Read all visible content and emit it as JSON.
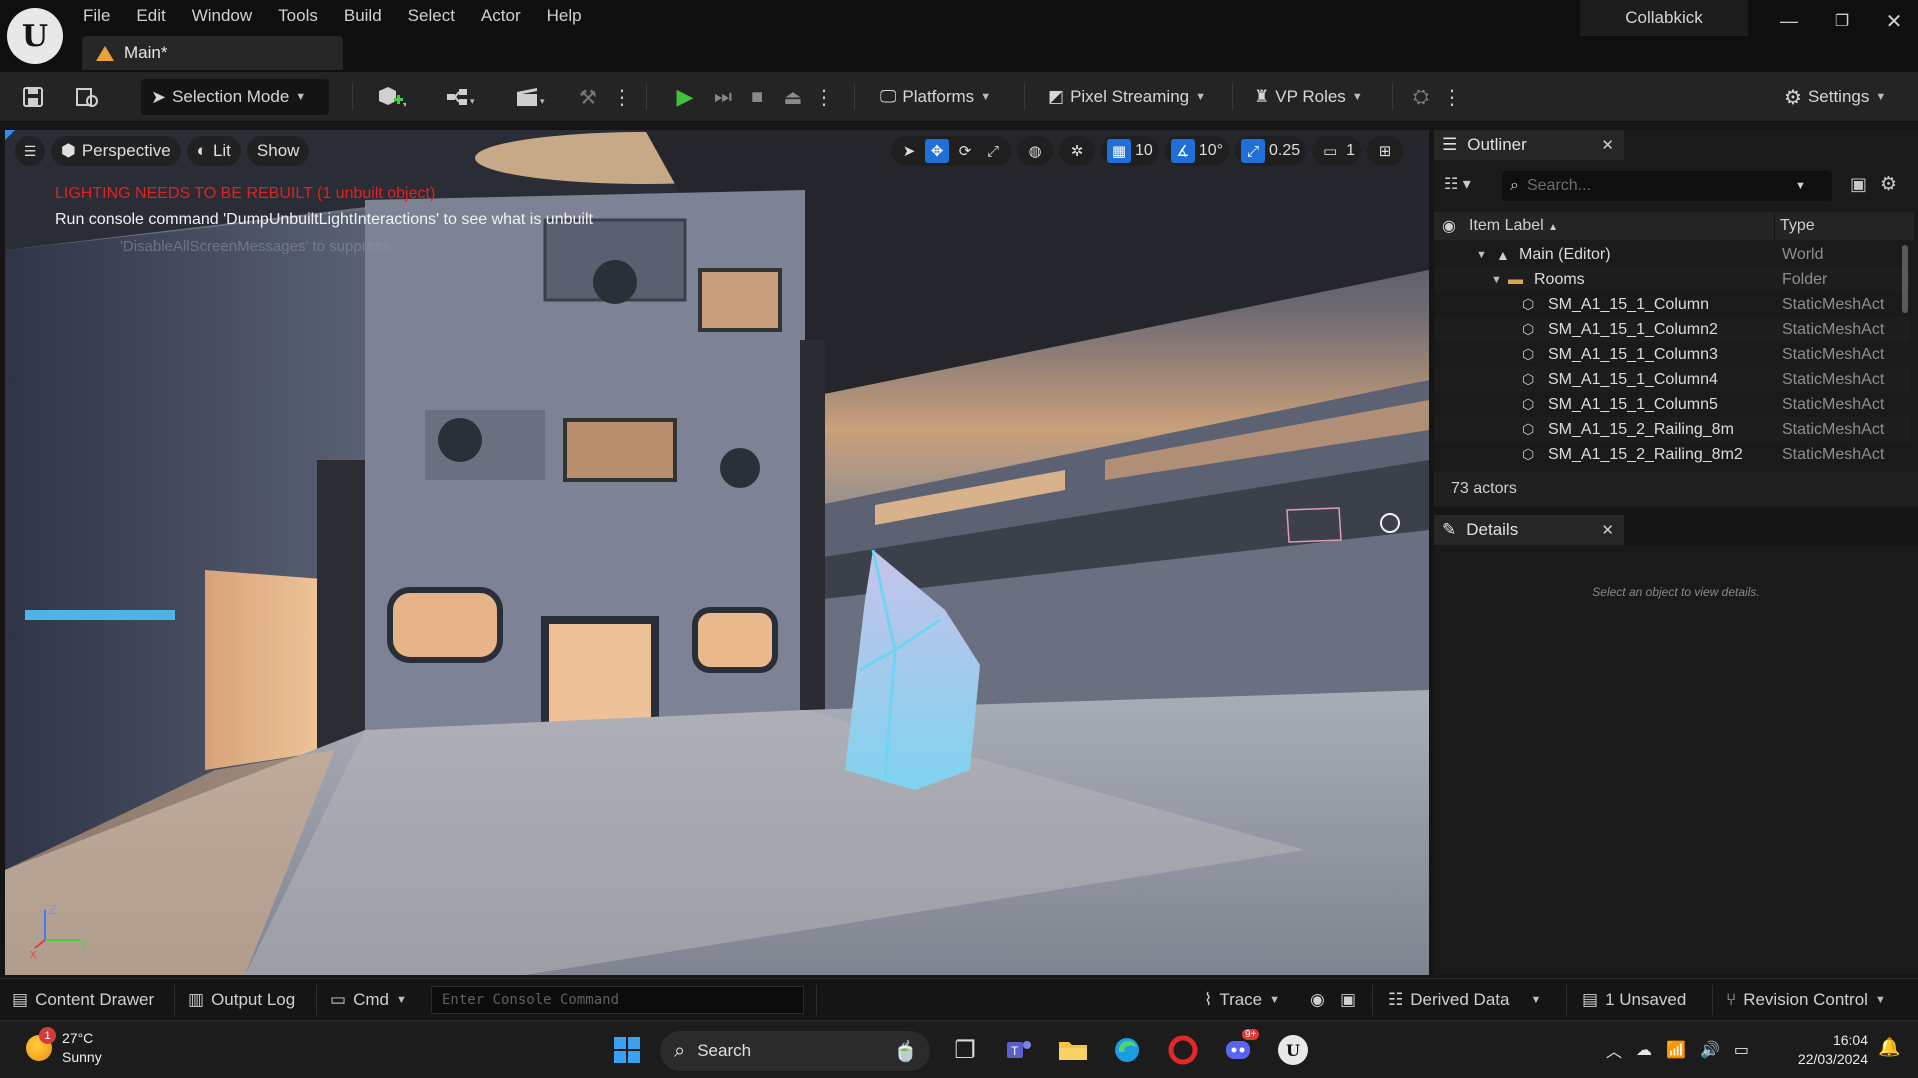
{
  "app": {
    "menu": [
      "File",
      "Edit",
      "Window",
      "Tools",
      "Build",
      "Select",
      "Actor",
      "Help"
    ],
    "document_tab": "Main*",
    "project_name": "Collabkick"
  },
  "toolbar": {
    "mode_label": "Selection Mode",
    "platforms_label": "Platforms",
    "pixel_streaming_label": "Pixel Streaming",
    "vp_roles_label": "VP Roles",
    "settings_label": "Settings"
  },
  "viewport": {
    "perspective_label": "Perspective",
    "lit_label": "Lit",
    "show_label": "Show",
    "grid_snap": "10",
    "rotation_snap": "10°",
    "scale_snap": "0.25",
    "camera_speed": "1",
    "warning_message": "LIGHTING NEEDS TO BE REBUILT (1 unbuilt object)",
    "info_message": "Run console command 'DumpUnbuiltLightInteractions' to see what is unbuilt",
    "faint_message": "'DisableAllScreenMessages' to suppress",
    "axis": {
      "x": "x",
      "y": "y",
      "z": "Z"
    }
  },
  "outliner": {
    "title": "Outliner",
    "search_placeholder": "Search...",
    "col_label": "Item Label",
    "col_type": "Type",
    "rows": [
      {
        "label": "Main (Editor)",
        "type": "World"
      },
      {
        "label": "Rooms",
        "type": "Folder"
      },
      {
        "label": "SM_A1_15_1_Column",
        "type": "StaticMeshAct"
      },
      {
        "label": "SM_A1_15_1_Column2",
        "type": "StaticMeshAct"
      },
      {
        "label": "SM_A1_15_1_Column3",
        "type": "StaticMeshAct"
      },
      {
        "label": "SM_A1_15_1_Column4",
        "type": "StaticMeshAct"
      },
      {
        "label": "SM_A1_15_1_Column5",
        "type": "StaticMeshAct"
      },
      {
        "label": "SM_A1_15_2_Railing_8m",
        "type": "StaticMeshAct"
      },
      {
        "label": "SM_A1_15_2_Railing_8m2",
        "type": "StaticMeshAct"
      }
    ],
    "footer": "73 actors"
  },
  "details": {
    "title": "Details",
    "empty_message": "Select an object to view details."
  },
  "statusbar": {
    "content_drawer": "Content Drawer",
    "output_log": "Output Log",
    "cmd": "Cmd",
    "console_placeholder": "Enter Console Command",
    "trace": "Trace",
    "derived_data": "Derived Data",
    "unsaved": "1 Unsaved",
    "revision_control": "Revision Control"
  },
  "taskbar": {
    "temperature": "27°C",
    "condition": "Sunny",
    "weather_badge": "1",
    "search_label": "Search",
    "discord_badge": "9+",
    "time": "16:04",
    "date": "22/03/2024"
  }
}
